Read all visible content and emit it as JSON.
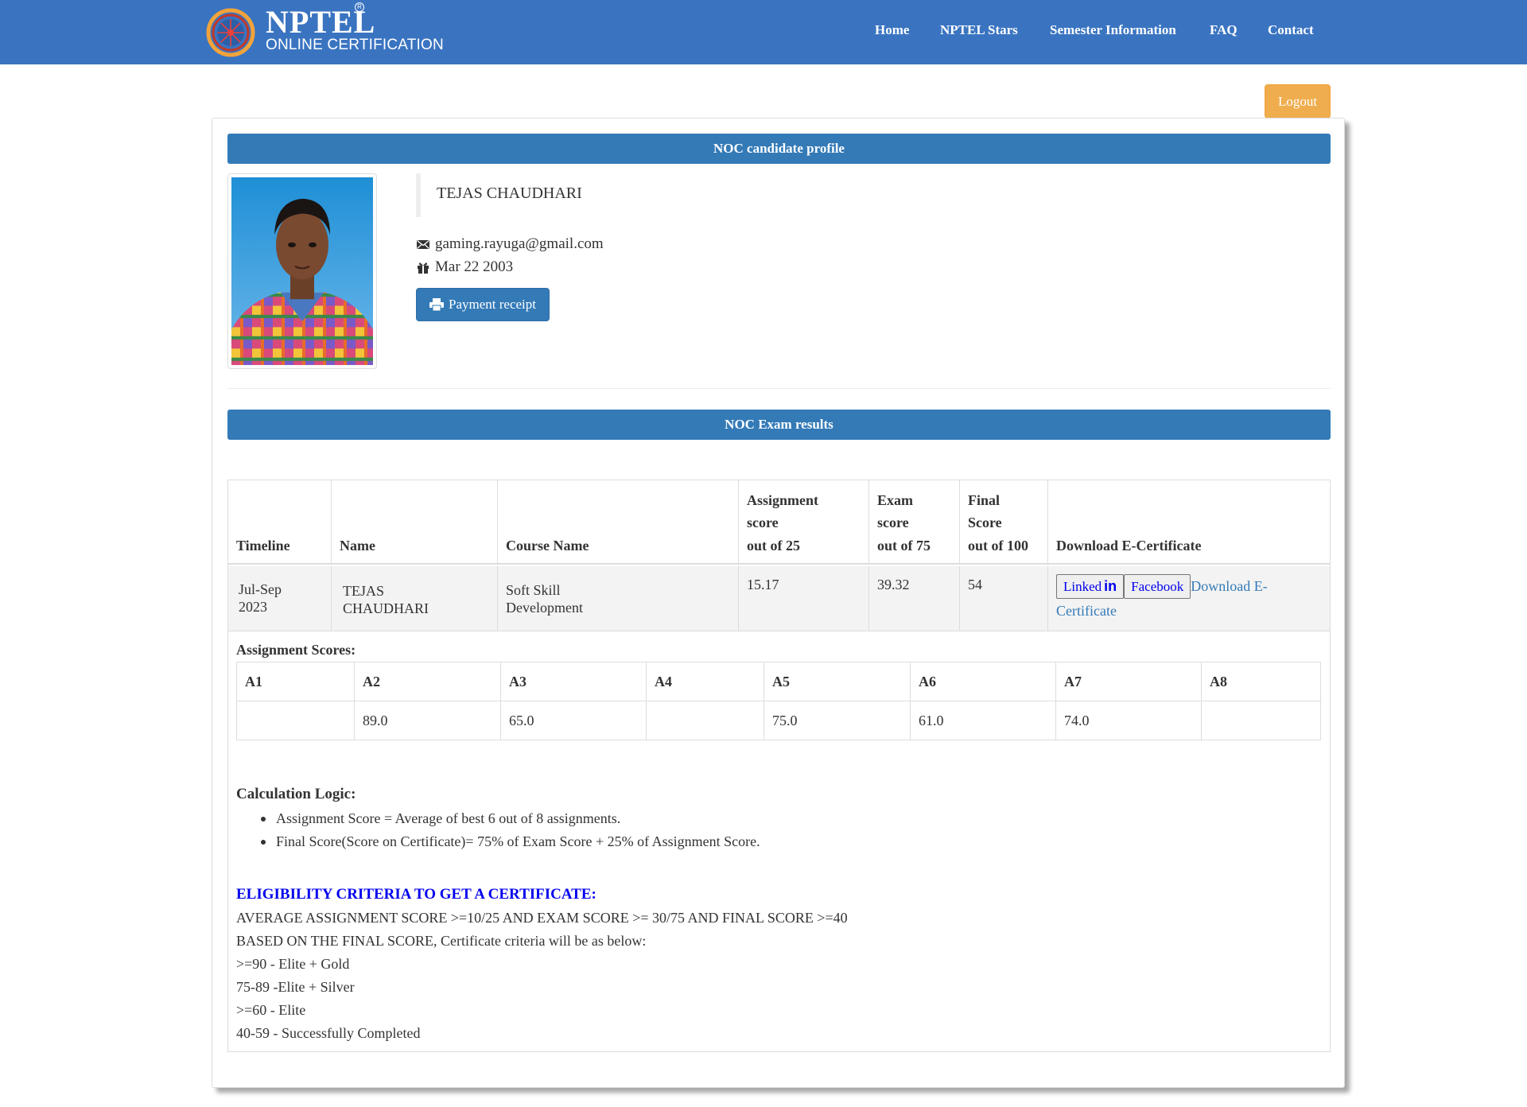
{
  "brand": {
    "name": "NPTEL",
    "registered_mark": "R",
    "subtitle": "ONLINE CERTIFICATION"
  },
  "nav": {
    "home": "Home",
    "stars": "NPTEL Stars",
    "semester": "Semester Information",
    "faq": "FAQ",
    "contact": "Contact"
  },
  "logout_label": "Logout",
  "profile": {
    "header": "NOC candidate profile",
    "name": "TEJAS CHAUDHARI",
    "email": "gaming.rayuga@gmail.com",
    "dob": "Mar 22 2003",
    "payment_button": "Payment receipt",
    "icons": [
      "envelope-icon",
      "gift-icon",
      "print-icon"
    ]
  },
  "results": {
    "header": "NOC Exam results",
    "columns": {
      "timeline": "Timeline",
      "name": "Name",
      "course": "Course Name",
      "assignment_1": "Assignment",
      "assignment_2": "score",
      "assignment_3": "out of 25",
      "exam_1": "Exam",
      "exam_2": "score",
      "exam_3": "out of 75",
      "final_1": "Final",
      "final_2": "Score",
      "final_3": "out of 100",
      "download": "Download E-Certificate"
    },
    "row": {
      "timeline_1": "Jul-Sep",
      "timeline_2": "2023",
      "name_1": "TEJAS",
      "name_2": "CHAUDHARI",
      "course_1": "Soft Skill",
      "course_2": "Development",
      "assignment_score": "15.17",
      "exam_score": "39.32",
      "final_score": "54",
      "linkedin_label": "Linked",
      "linkedin_suffix": "in",
      "facebook_label": "Facebook",
      "download_1": "Download E-",
      "download_2": "Certificate"
    }
  },
  "assignments": {
    "title": "Assignment Scores:",
    "headers": [
      "A1",
      "A2",
      "A3",
      "A4",
      "A5",
      "A6",
      "A7",
      "A8"
    ],
    "values": [
      "",
      "89.0",
      "65.0",
      "",
      "75.0",
      "61.0",
      "74.0",
      ""
    ]
  },
  "calculation": {
    "title": "Calculation Logic:",
    "items": [
      "Assignment Score = Average of best 6 out of 8 assignments.",
      "Final Score(Score on Certificate)= 75% of Exam Score + 25% of Assignment Score."
    ]
  },
  "eligibility": {
    "title": "ELIGIBILITY CRITERIA TO GET A CERTIFICATE:",
    "lines": [
      "AVERAGE ASSIGNMENT SCORE >=10/25 AND EXAM SCORE >= 30/75 AND FINAL SCORE >=40",
      "BASED ON THE FINAL SCORE, Certificate criteria will be as below:",
      ">=90 - Elite + Gold",
      "75-89 -Elite + Silver",
      ">=60 - Elite",
      "40-59 - Successfully Completed"
    ]
  },
  "colors": {
    "navbar": "#3a74c1",
    "header_bar": "#337ab7",
    "logout": "#f0ad4e",
    "link": "#337ab7",
    "eligibility_title": "#0000ee"
  }
}
